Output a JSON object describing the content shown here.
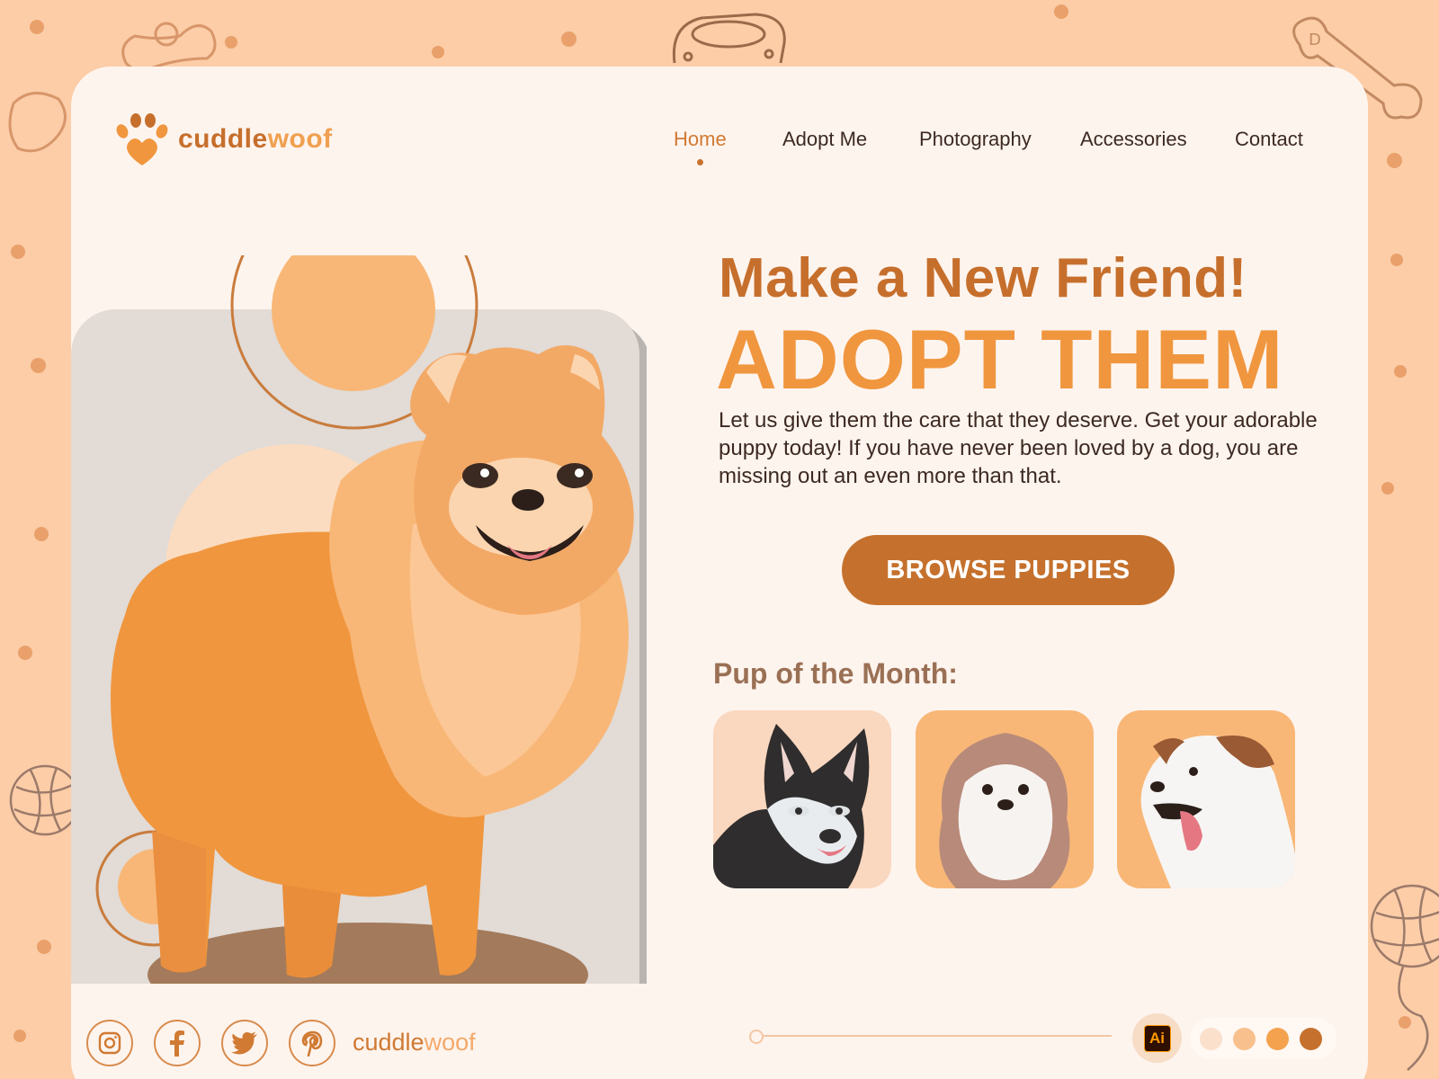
{
  "brand": {
    "name_part1": "cuddle",
    "name_part2": "woof"
  },
  "nav": {
    "items": [
      {
        "label": "Home",
        "active": true
      },
      {
        "label": "Adopt Me",
        "active": false
      },
      {
        "label": "Photography",
        "active": false
      },
      {
        "label": "Accessories",
        "active": false
      },
      {
        "label": "Contact",
        "active": false
      }
    ]
  },
  "hero": {
    "title_line1": "Make a New Friend!",
    "title_line2": "ADOPT THEM",
    "description": "Let us give them the care that they deserve. Get your adorable puppy today! If you have never been loved by a dog, you are missing out an even more than that.",
    "cta_label": "BROWSE PUPPIES"
  },
  "pup_of_month": {
    "heading": "Pup of the Month:",
    "pups": [
      {
        "icon": "husky-portrait"
      },
      {
        "icon": "shih-tzu-portrait"
      },
      {
        "icon": "jack-russell-portrait"
      }
    ]
  },
  "footer": {
    "social": [
      {
        "icon": "instagram-icon"
      },
      {
        "icon": "facebook-icon"
      },
      {
        "icon": "twitter-icon"
      },
      {
        "icon": "pinterest-icon"
      }
    ],
    "brand_part1": "cuddle",
    "brand_part2": "woof",
    "badge_label": "Ai",
    "swatches": [
      "#fbe0cc",
      "#f8c08c",
      "#f4a24e",
      "#c5712d"
    ]
  },
  "colors": {
    "accent": "#c5712d",
    "accent_light": "#f0963e",
    "page_bg": "#fccda7",
    "card_bg": "#fef4ee"
  }
}
